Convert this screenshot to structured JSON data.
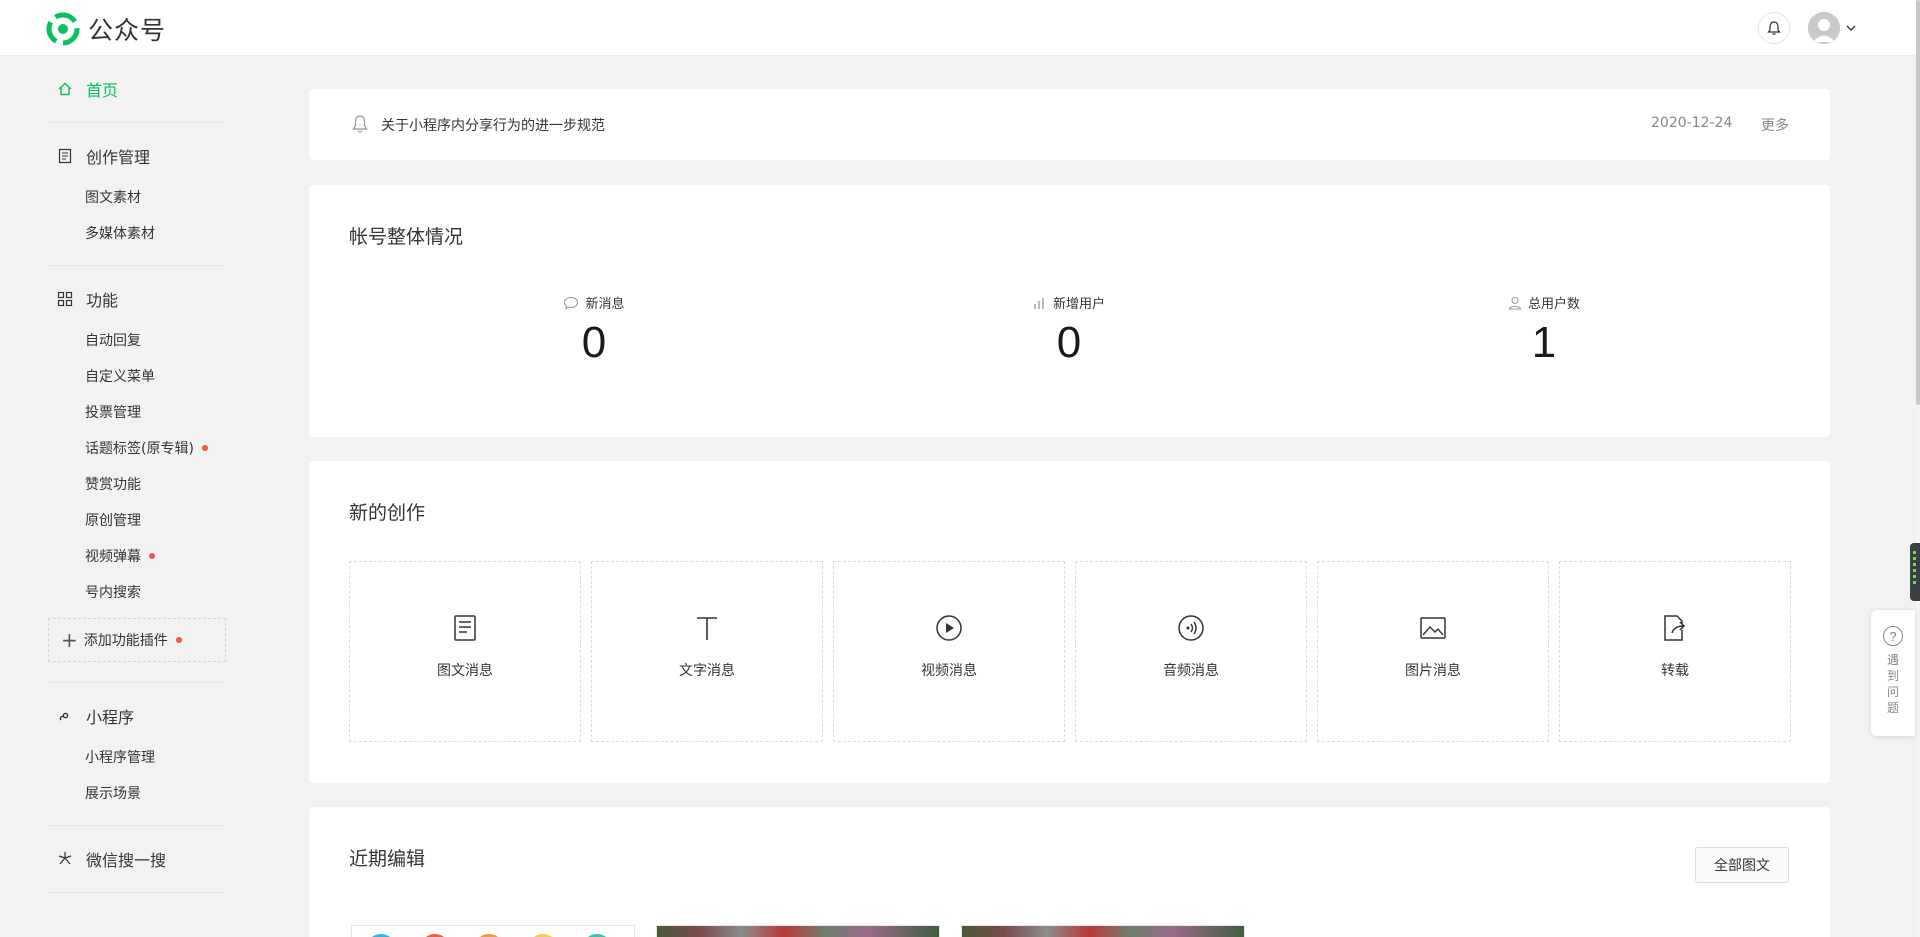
{
  "app": {
    "name": "公众号",
    "brand_color": "#07c160"
  },
  "header": {
    "bell_icon": "bell-icon",
    "avatar_icon": "user-avatar"
  },
  "sidebar": {
    "home": {
      "label": "首页",
      "icon": "home-icon"
    },
    "sections": [
      {
        "label": "创作管理",
        "icon": "document-icon",
        "items": [
          "图文素材",
          "多媒体素材"
        ]
      },
      {
        "label": "功能",
        "icon": "grid-icon",
        "items": [
          "自动回复",
          "自定义菜单",
          "投票管理",
          "话题标签(原专辑)",
          "赞赏功能",
          "原创管理",
          "视频弹幕",
          "号内搜索"
        ],
        "add_plugin": "添加功能插件"
      },
      {
        "label": "小程序",
        "icon": "link-icon",
        "items": [
          "小程序管理",
          "展示场景"
        ]
      },
      {
        "label": "微信搜一搜",
        "icon": "sparkle-icon",
        "items": []
      }
    ]
  },
  "notice": {
    "text": "关于小程序内分享行为的进一步规范",
    "date": "2020-12-24",
    "more": "更多"
  },
  "overview": {
    "title": "帐号整体情况",
    "stats": [
      {
        "label": "新消息",
        "value": "0",
        "icon": "chat-icon"
      },
      {
        "label": "新增用户",
        "value": "0",
        "icon": "bar-chart-icon"
      },
      {
        "label": "总用户数",
        "value": "1",
        "icon": "user-icon"
      }
    ]
  },
  "create": {
    "title": "新的创作",
    "items": [
      {
        "label": "图文消息",
        "icon": "article-icon"
      },
      {
        "label": "文字消息",
        "icon": "text-icon"
      },
      {
        "label": "视频消息",
        "icon": "video-play-icon"
      },
      {
        "label": "音频消息",
        "icon": "audio-icon"
      },
      {
        "label": "图片消息",
        "icon": "image-icon"
      },
      {
        "label": "转载",
        "icon": "repost-icon"
      }
    ]
  },
  "recent": {
    "title": "近期编辑",
    "all_button": "全部图文"
  },
  "help": {
    "text": "遇到问题",
    "icon": "question-icon"
  }
}
